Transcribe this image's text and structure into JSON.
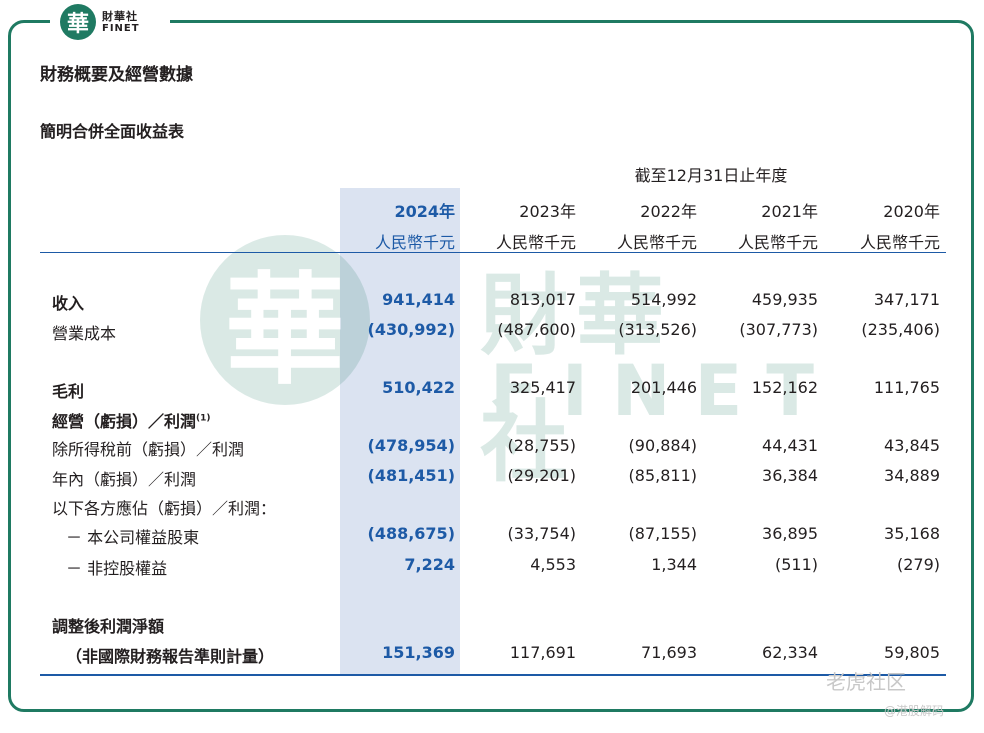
{
  "brand": {
    "logo_glyph": "華",
    "name_cn": "財華社",
    "name_en": "FINET",
    "color": "#1f7a62"
  },
  "section_title": "財務概要及經營數據",
  "table_title": "簡明合併全面收益表",
  "period_header": "截至12月31日止年度",
  "columns": [
    {
      "year": "2024年",
      "unit": "人民幣千元",
      "highlight": true
    },
    {
      "year": "2023年",
      "unit": "人民幣千元"
    },
    {
      "year": "2022年",
      "unit": "人民幣千元"
    },
    {
      "year": "2021年",
      "unit": "人民幣千元"
    },
    {
      "year": "2020年",
      "unit": "人民幣千元"
    }
  ],
  "rows": [
    {
      "label": "收入",
      "bold": true,
      "values": [
        "941,414",
        "813,017",
        "514,992",
        "459,935",
        "347,171"
      ]
    },
    {
      "label": "營業成本",
      "bold": false,
      "values": [
        "(430,992)",
        "(487,600)",
        "(313,526)",
        "(307,773)",
        "(235,406)"
      ]
    },
    {
      "label": "毛利",
      "bold": true,
      "values": [
        "510,422",
        "325,417",
        "201,446",
        "152,162",
        "111,765"
      ]
    },
    {
      "label": "經營（虧損）／利潤",
      "note": "(1)",
      "bold": true,
      "values": [
        "",
        "",
        "",
        "",
        ""
      ]
    },
    {
      "label": "除所得稅前（虧損）／利潤",
      "bold": false,
      "values": [
        "(478,954)",
        "(28,755)",
        "(90,884)",
        "44,431",
        "43,845"
      ]
    },
    {
      "label": "年內（虧損）／利潤",
      "bold": false,
      "values": [
        "(481,451)",
        "(29,201)",
        "(85,811)",
        "36,384",
        "34,889"
      ]
    },
    {
      "label": "以下各方應佔（虧損）／利潤：",
      "bold": false,
      "values": [
        "",
        "",
        "",
        "",
        ""
      ]
    },
    {
      "label": "－ 本公司權益股東",
      "bold": false,
      "indent": true,
      "values": [
        "(488,675)",
        "(33,754)",
        "(87,155)",
        "36,895",
        "35,168"
      ]
    },
    {
      "label": "－ 非控股權益",
      "bold": false,
      "indent": true,
      "values": [
        "7,224",
        "4,553",
        "1,344",
        "(511)",
        "(279)"
      ]
    },
    {
      "label": "調整後利潤淨額",
      "bold": true,
      "values": [
        "",
        "",
        "",
        "",
        ""
      ]
    },
    {
      "label": "（非國際財務報告準則計量）",
      "bold": true,
      "values": [
        "151,369",
        "117,691",
        "71,693",
        "62,334",
        "59,805"
      ]
    }
  ],
  "watermark": {
    "glyph": "華",
    "cn": "財華社",
    "en": "FINET"
  },
  "corner_watermark": {
    "main": "老虎社区",
    "sub": "@港股解码"
  },
  "colors": {
    "highlight_bg": "#dbe3f1",
    "accent_blue": "#1d5aa6",
    "frame": "#1f7a62"
  }
}
